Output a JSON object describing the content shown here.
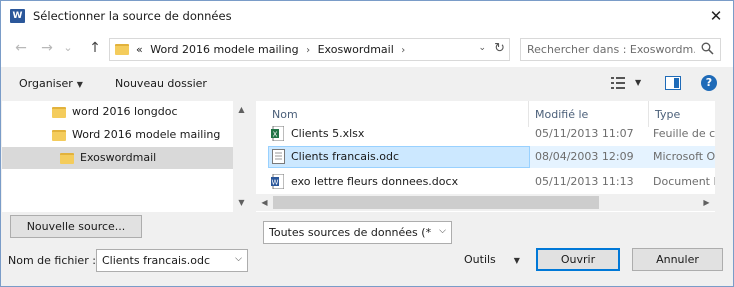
{
  "window": {
    "title": "Sélectionner la source de données",
    "app_icon_letter": "W",
    "close_glyph": "✕"
  },
  "nav": {
    "back_glyph": "←",
    "forward_glyph": "→",
    "history_glyph": "⌄",
    "up_glyph": "↑",
    "overflow": "«",
    "breadcrumbs": [
      "Word 2016 modele mailing",
      "Exoswordmail"
    ],
    "separator": "›",
    "dropdown_glyph": "⌄",
    "refresh_glyph": "↻",
    "search_placeholder": "Rechercher dans : Exoswordm..."
  },
  "toolbar": {
    "organize_label": "Organiser",
    "new_folder_label": "Nouveau dossier",
    "help_label": "?"
  },
  "tree": {
    "items": [
      {
        "label": "word 2016 longdoc"
      },
      {
        "label": "Word 2016 modele mailing"
      },
      {
        "label": "Exoswordmail",
        "selected": true
      }
    ],
    "scroll_up": "▲",
    "scroll_down": "▼"
  },
  "filelist": {
    "columns": {
      "name": "Nom",
      "modified": "Modifié le",
      "type": "Type"
    },
    "sort_glyph": "^",
    "files": [
      {
        "name": "Clients 5.xlsx",
        "modified": "05/11/2013 11:07",
        "type": "Feuille de ca",
        "icon": "excel-file-icon"
      },
      {
        "name": "Clients francais.odc",
        "modified": "08/04/2003 12:09",
        "type": "Microsoft O",
        "icon": "odc-file-icon",
        "selected": true
      },
      {
        "name": "exo lettre fleurs donnees.docx",
        "modified": "05/11/2013 11:13",
        "type": "Document M",
        "icon": "word-file-icon"
      }
    ],
    "scroll_left": "◀",
    "scroll_right": "▶"
  },
  "bottom": {
    "new_source_label": "Nouvelle source...",
    "filter_value": "Toutes sources de données (*.o",
    "filename_label": "Nom de fichier :",
    "filename_value": "Clients francais.odc",
    "tools_label": "Outils",
    "open_label": "Ouvrir",
    "cancel_label": "Annuler"
  },
  "colors": {
    "accent": "#0078d7",
    "selection": "#cce8ff",
    "folder": "#f4cc5c",
    "word_blue": "#2b579a",
    "excel_green": "#217346"
  }
}
